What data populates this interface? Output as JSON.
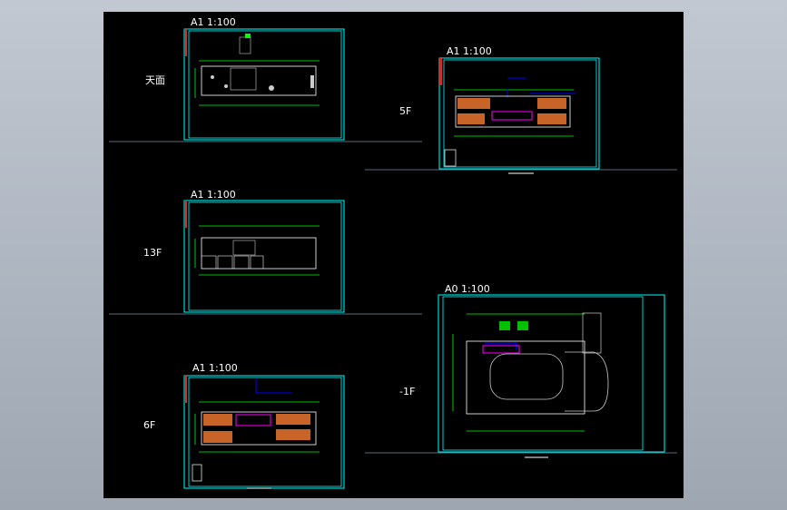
{
  "scales": {
    "roof": "A1 1:100",
    "f13": "A1 1:100",
    "f6": "A1 1:100",
    "f5": "A1 1:100",
    "b1": "A0 1:100"
  },
  "floors": {
    "roof": "天面",
    "f13": "13F",
    "f6": "6F",
    "f5": "5F",
    "b1": "-1F"
  },
  "colors": {
    "frame": "#00ffff",
    "wall": "#ffffff",
    "dim": "#00ff00",
    "duct": "#0000ff",
    "room": "#c86428",
    "pipe": "#ff00ff",
    "green_block": "#00c000"
  }
}
